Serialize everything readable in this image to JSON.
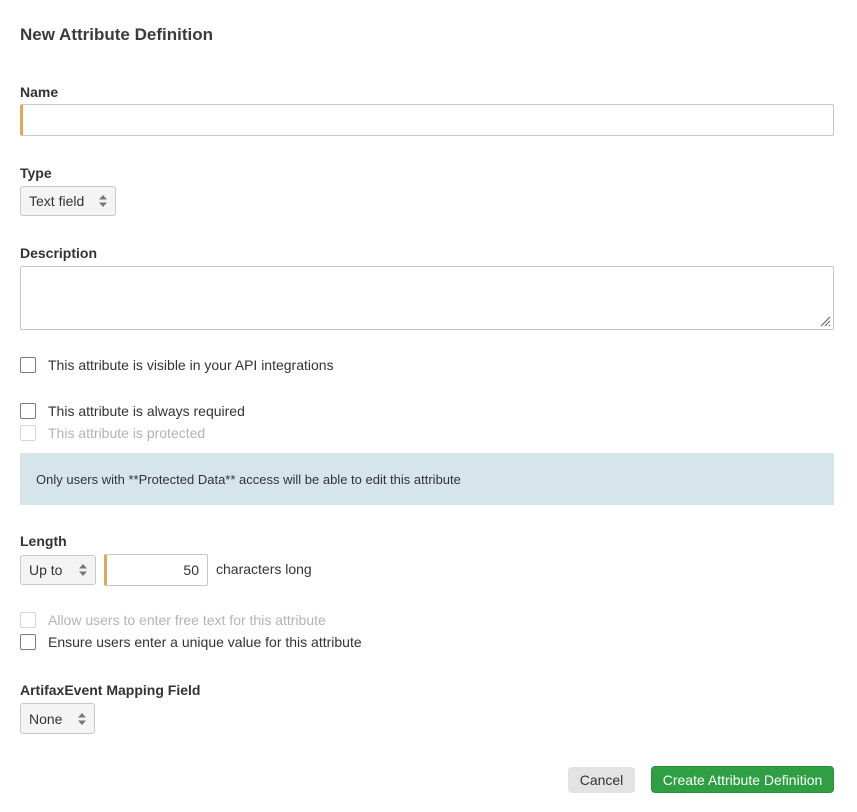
{
  "form": {
    "title": "New Attribute Definition",
    "name_label": "Name",
    "name_value": "",
    "type_label": "Type",
    "type_value": "Text field",
    "description_label": "Description",
    "description_value": ""
  },
  "checkboxes": {
    "api_visible": {
      "label": "This attribute is visible in your API integrations",
      "checked": false
    },
    "required": {
      "label": "This attribute is always required",
      "checked": false
    },
    "protected": {
      "label": "This attribute is protected",
      "checked": false,
      "disabled": true
    }
  },
  "notice": {
    "text": "Only users with **Protected Data** access will be able to edit this attribute"
  },
  "length": {
    "label": "Length",
    "mode_value": "Up to",
    "count_value": "50",
    "suffix": "characters long"
  },
  "options": {
    "free_text": {
      "label": "Allow users to enter free text for this attribute",
      "checked": false,
      "disabled": true
    },
    "unique": {
      "label": "Ensure users enter a unique value for this attribute",
      "checked": false
    }
  },
  "mapping": {
    "label": "ArtifaxEvent Mapping Field",
    "value": "None"
  },
  "actions": {
    "cancel_label": "Cancel",
    "create_label": "Create Attribute Definition"
  },
  "colors": {
    "accent_border": "#e0a95a",
    "notice_bg": "#d6e4eb",
    "primary_button": "#2ea043"
  },
  "icons": {
    "select_arrows": "updown-arrows-icon",
    "resize_handle": "resize-handle-icon"
  }
}
